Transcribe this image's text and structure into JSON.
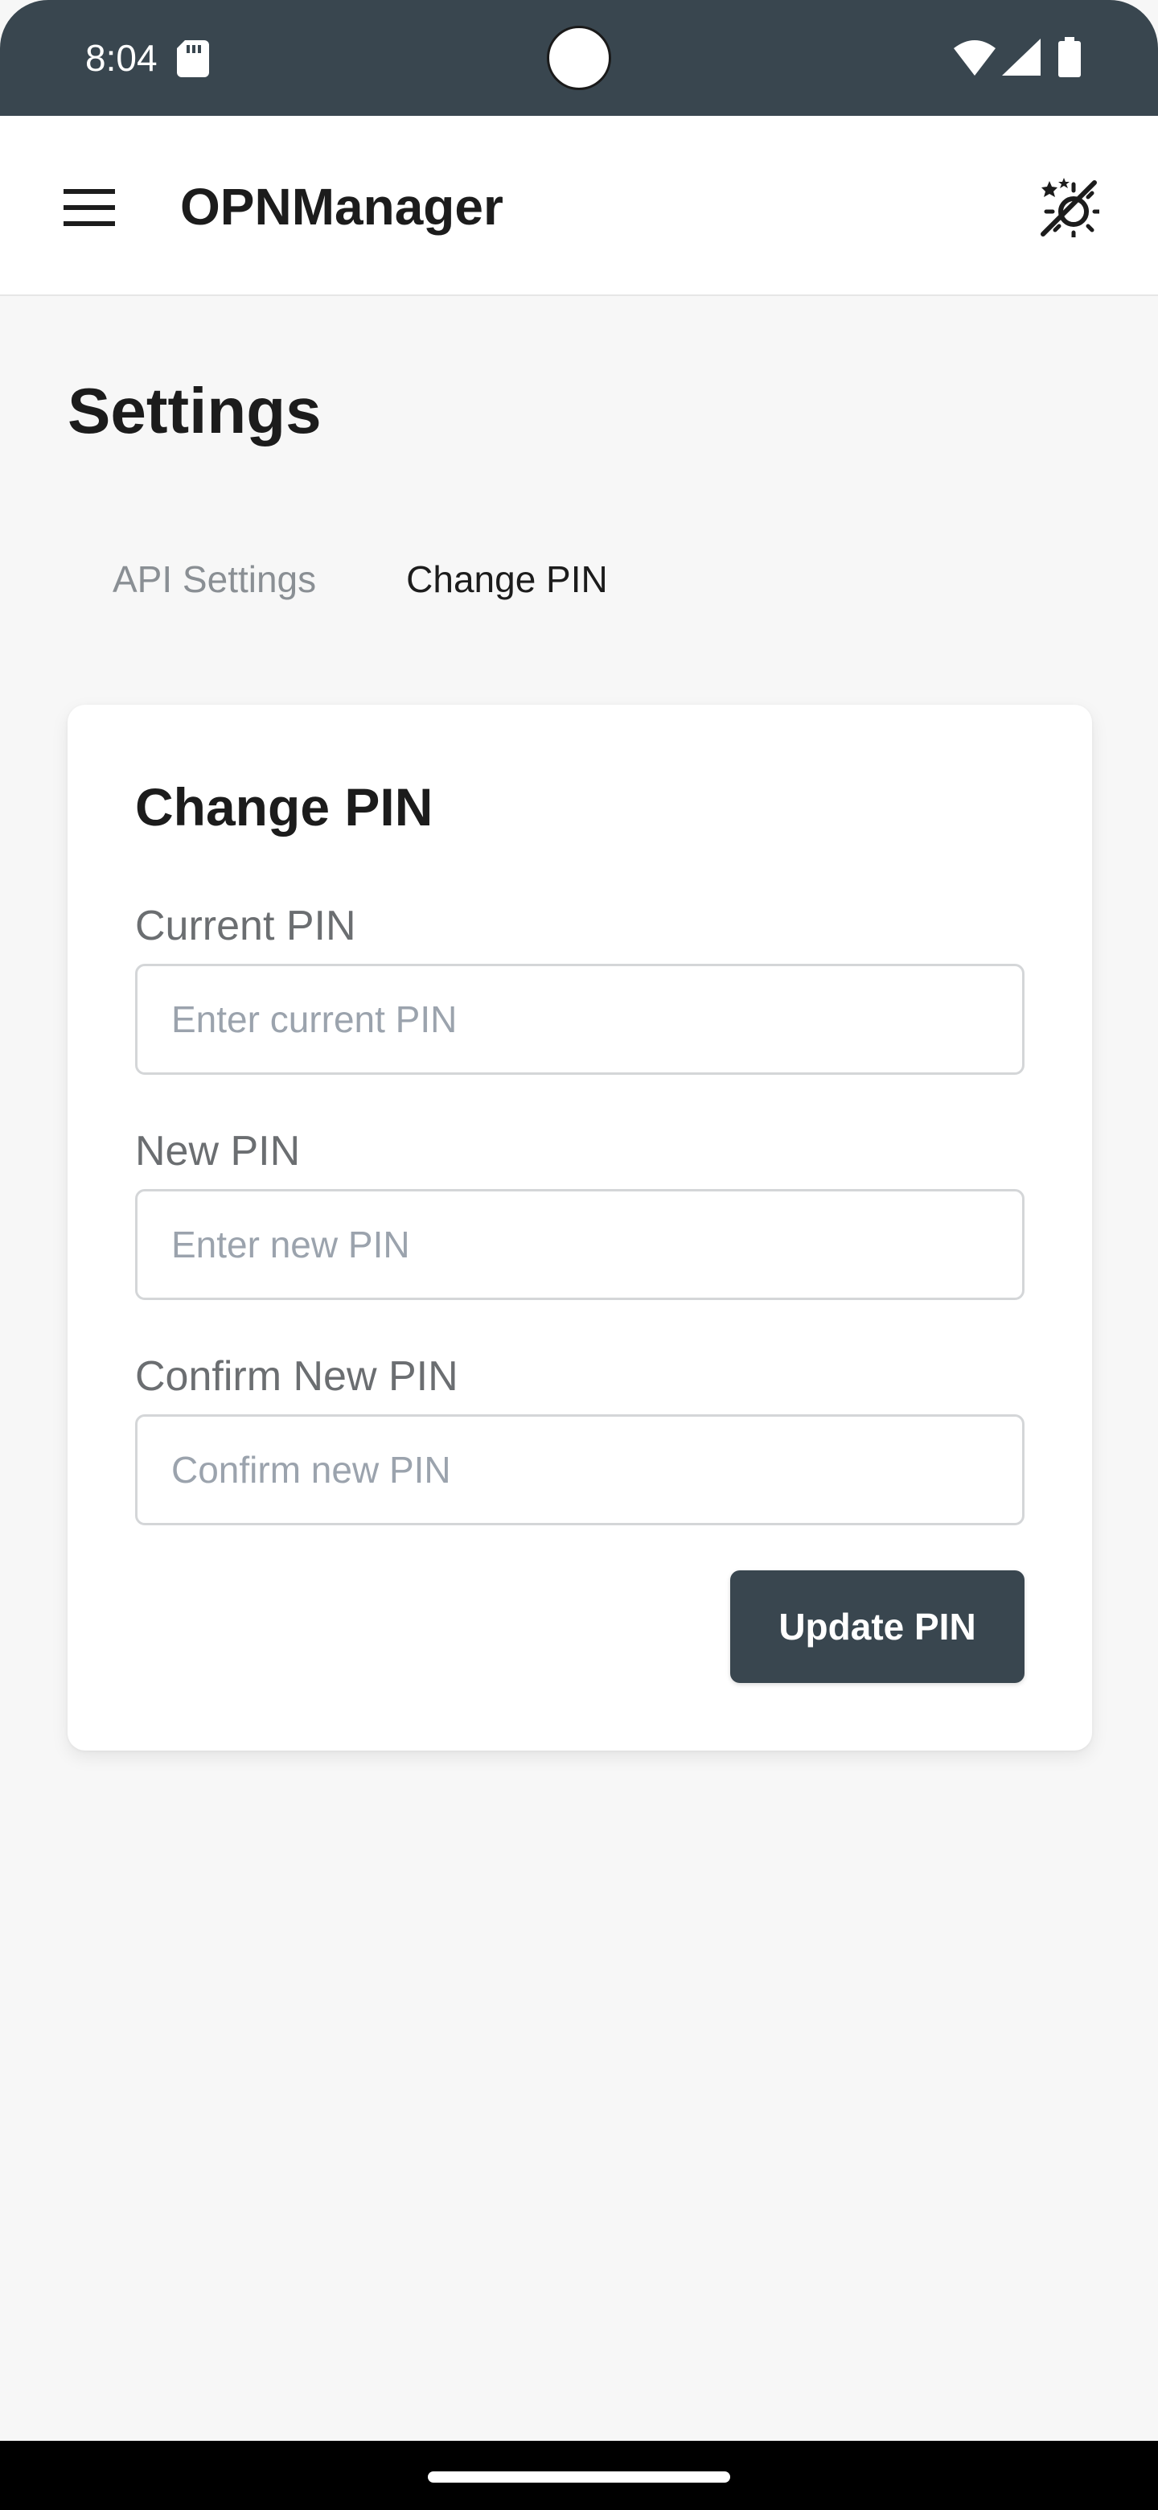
{
  "status_bar": {
    "time": "8:04",
    "icons": [
      "sd-card-icon",
      "wifi-icon",
      "signal-icon",
      "battery-icon"
    ]
  },
  "app_bar": {
    "title": "OPNManager",
    "menu_icon": "hamburger-menu-icon",
    "theme_icon": "theme-toggle-icon"
  },
  "page": {
    "title": "Settings",
    "tabs": [
      {
        "label": "API Settings",
        "active": false
      },
      {
        "label": "Change PIN",
        "active": true
      }
    ]
  },
  "form": {
    "title": "Change PIN",
    "current_pin": {
      "label": "Current PIN",
      "placeholder": "Enter current PIN",
      "value": ""
    },
    "new_pin": {
      "label": "New PIN",
      "placeholder": "Enter new PIN",
      "value": ""
    },
    "confirm_pin": {
      "label": "Confirm New PIN",
      "placeholder": "Confirm new PIN",
      "value": ""
    },
    "submit_label": "Update PIN"
  },
  "colors": {
    "primary": "#39464f",
    "background": "#f7f7f7",
    "surface": "#ffffff",
    "inactive_tab": "#8a8f94",
    "placeholder": "#9ba3ad"
  }
}
